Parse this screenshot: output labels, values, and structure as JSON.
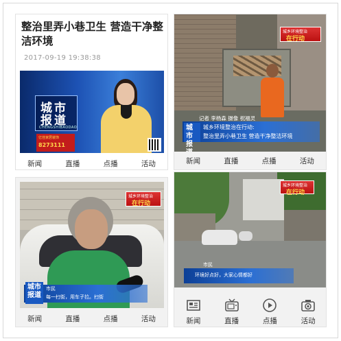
{
  "article": {
    "headline": "整治里弄小巷卫生 营造干净整洁环境",
    "date": "2017-09-19 19:38:38"
  },
  "nav": {
    "news": "新闻",
    "live": "直播",
    "vod": "点播",
    "activity": "活动"
  },
  "panel1": {
    "logo_line1": "城市",
    "logo_line2": "报道",
    "logo_sub": "CHENGSHIBAODAO",
    "ad_line1": "亿佳家居装饰",
    "ad_line2": "8273111"
  },
  "panel2": {
    "badge_line1": "城乡环境整治",
    "badge_line2": "在行动",
    "credits": "记者 李杨森 摄像 祝福灵",
    "caption_top": "城乡环境整治在行动:",
    "caption_main": "整治里弄小巷卫生  营造干净整洁环境",
    "logo": "城市报道"
  },
  "panel3": {
    "badge_line1": "城乡环境整治",
    "badge_line2": "在行动",
    "speaker": "市民",
    "quote": "每一扫街，用车子拉。扫街",
    "logo": "城市报道"
  },
  "panel4": {
    "badge_line1": "城乡环境整治",
    "badge_line2": "在行动",
    "speaker": "市民",
    "quote": "环境好点好，大家心情都好",
    "icons": [
      "newspaper-icon",
      "tv-icon",
      "play-icon",
      "camera-icon"
    ]
  },
  "colors": {
    "brand_blue": "#1d52b4",
    "badge_red": "#c21c1c",
    "accent_orange": "#e9681f"
  }
}
